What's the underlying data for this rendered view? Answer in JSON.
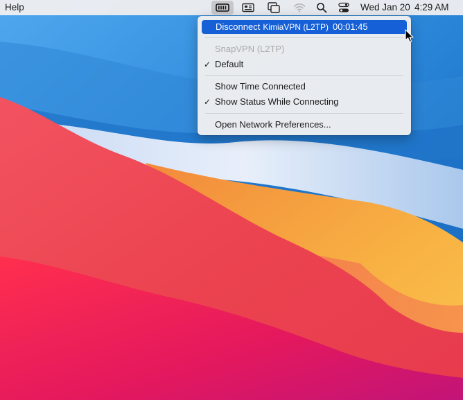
{
  "menubar": {
    "app_menu": "Help",
    "date": "Wed Jan 20",
    "time": "4:29 AM",
    "status_icons": [
      "vpn-icon",
      "input-source-icon",
      "screen-mirroring-icon",
      "wifi-icon",
      "spotlight-search-icon",
      "control-center-icon"
    ]
  },
  "vpn_menu": {
    "disconnect": {
      "action": "Disconnect",
      "service": "KimiaVPN (L2TP)",
      "timer": "00:01:45"
    },
    "configurations": [
      {
        "label": "SnapVPN (L2TP)",
        "enabled": false,
        "checked": false
      },
      {
        "label": "Default",
        "enabled": true,
        "checked": true
      }
    ],
    "options": [
      {
        "label": "Show Time Connected",
        "checked": false
      },
      {
        "label": "Show Status While Connecting",
        "checked": true
      }
    ],
    "preferences": "Open Network Preferences...",
    "check_mark": "✓"
  },
  "colors": {
    "highlight": "#1560d6",
    "wallpaper_blue": "#1e74c8",
    "wallpaper_red": "#ea3a4c",
    "wallpaper_orange": "#f6a23a"
  }
}
